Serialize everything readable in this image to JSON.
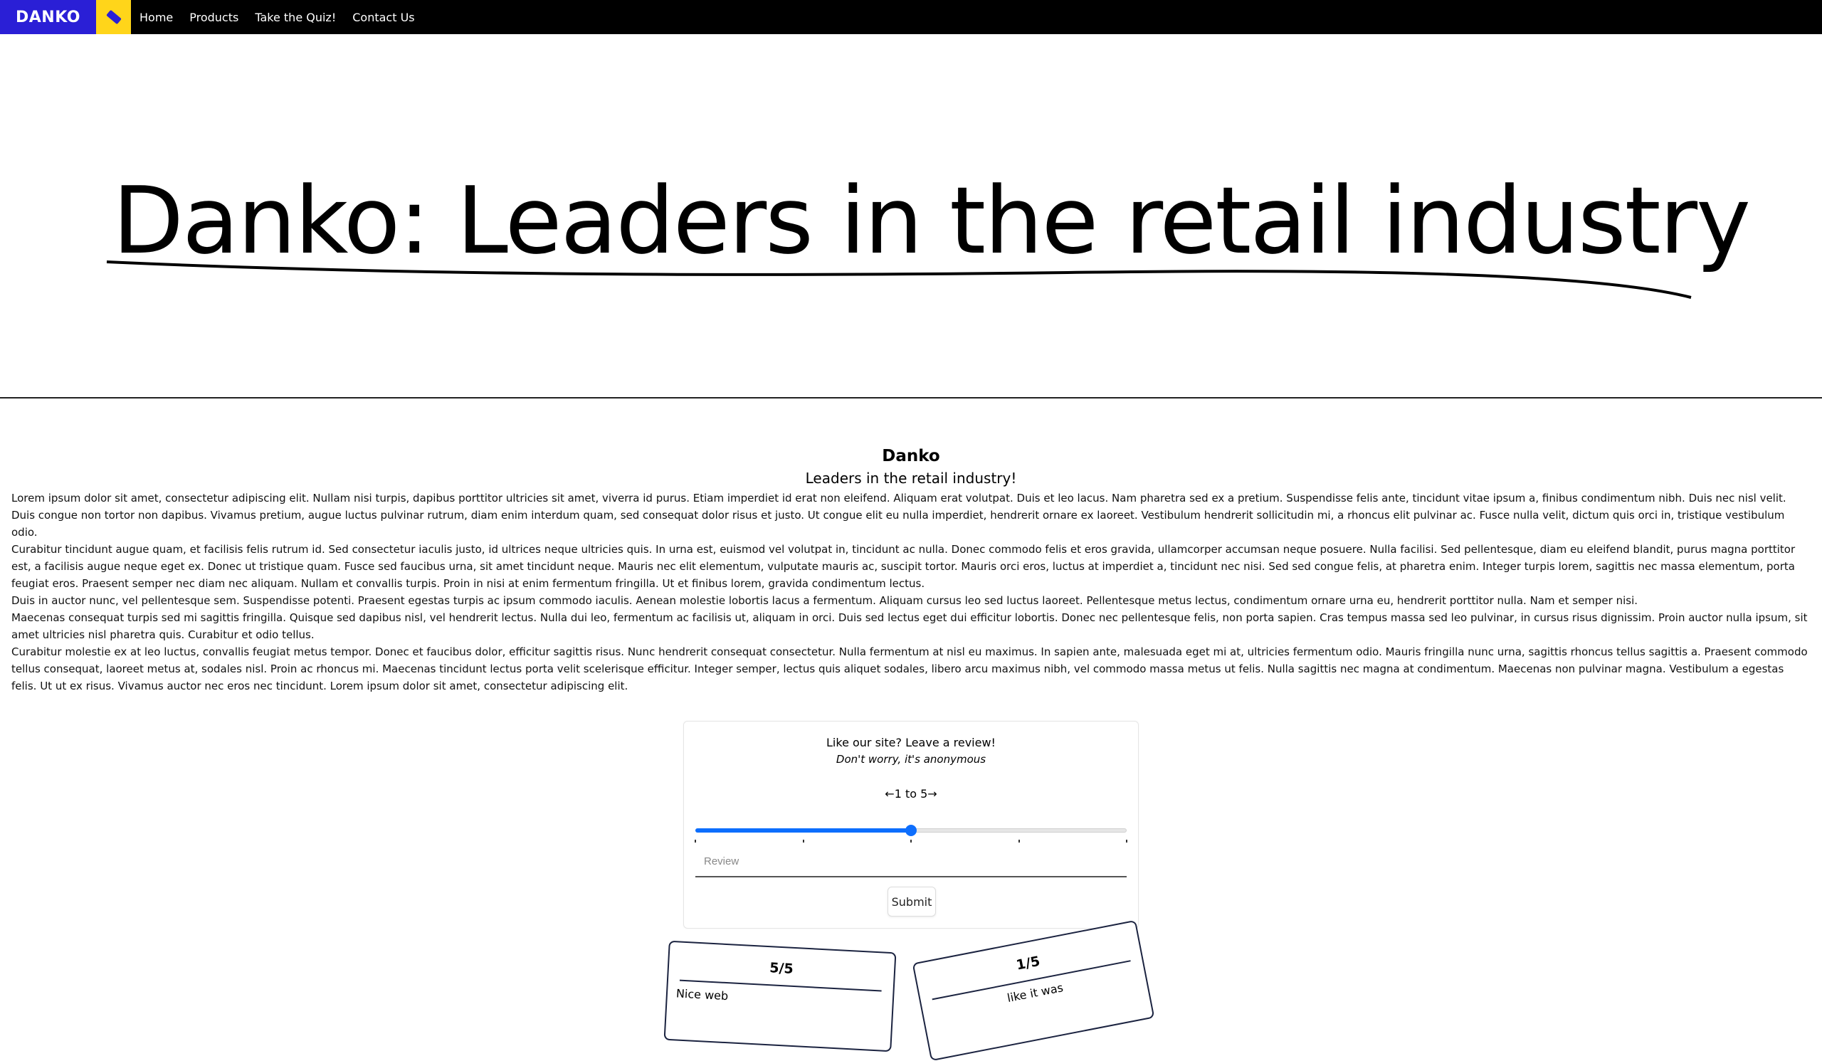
{
  "nav": {
    "brand": "DANKO",
    "links": [
      "Home",
      "Products",
      "Take the Quiz!",
      "Contact Us"
    ]
  },
  "hero": {
    "title": "Danko: Leaders in the retail industry"
  },
  "content": {
    "title": "Danko",
    "subtitle": "Leaders in the retail industry!",
    "paragraphs": [
      "Lorem ipsum dolor sit amet, consectetur adipiscing elit. Nullam nisi turpis, dapibus porttitor ultricies sit amet, viverra id purus. Etiam imperdiet id erat non eleifend. Aliquam erat volutpat. Duis et leo lacus. Nam pharetra sed ex a pretium. Suspendisse felis ante, tincidunt vitae ipsum a, finibus condimentum nibh. Duis nec nisl velit. Duis congue non tortor non dapibus. Vivamus pretium, augue luctus pulvinar rutrum, diam enim interdum quam, sed consequat dolor risus et justo. Ut congue elit eu nulla imperdiet, hendrerit ornare ex laoreet. Vestibulum hendrerit sollicitudin mi, a rhoncus elit pulvinar ac. Fusce nulla velit, dictum quis orci in, tristique vestibulum odio.",
      "Curabitur tincidunt augue quam, et facilisis felis rutrum id. Sed consectetur iaculis justo, id ultrices neque ultricies quis. In urna est, euismod vel volutpat in, tincidunt ac nulla. Donec commodo felis et eros gravida, ullamcorper accumsan neque posuere. Nulla facilisi. Sed pellentesque, diam eu eleifend blandit, purus magna porttitor est, a facilisis augue neque eget ex. Donec ut tristique quam. Fusce sed faucibus urna, sit amet tincidunt neque. Mauris nec elit elementum, vulputate mauris ac, suscipit tortor. Mauris orci eros, luctus at imperdiet a, tincidunt nec nisi. Sed sed congue felis, at pharetra enim. Integer turpis lorem, sagittis nec massa elementum, porta feugiat eros. Praesent semper nec diam nec aliquam. Nullam et convallis turpis. Proin in nisi at enim fermentum fringilla. Ut et finibus lorem, gravida condimentum lectus.",
      "Duis in auctor nunc, vel pellentesque sem. Suspendisse potenti. Praesent egestas turpis ac ipsum commodo iaculis. Aenean molestie lobortis lacus a fermentum. Aliquam cursus leo sed luctus laoreet. Pellentesque metus lectus, condimentum ornare urna eu, hendrerit porttitor nulla. Nam et semper nisi.",
      "Maecenas consequat turpis sed mi sagittis fringilla. Quisque sed dapibus nisl, vel hendrerit lectus. Nulla dui leo, fermentum ac facilisis ut, aliquam in orci. Duis sed lectus eget dui efficitur lobortis. Donec nec pellentesque felis, non porta sapien. Cras tempus massa sed leo pulvinar, in cursus risus dignissim. Proin auctor nulla ipsum, sit amet ultricies nisl pharetra quis. Curabitur et odio tellus.",
      "Curabitur molestie ex at leo luctus, convallis feugiat metus tempor. Donec et faucibus dolor, efficitur sagittis risus. Nunc hendrerit consequat consectetur. Nulla fermentum at nisl eu maximus. In sapien ante, malesuada eget mi at, ultricies fermentum odio. Mauris fringilla nunc urna, sagittis rhoncus tellus sagittis a. Praesent commodo tellus consequat, laoreet metus at, sodales nisl. Proin ac rhoncus mi. Maecenas tincidunt lectus porta velit scelerisque efficitur. Integer semper, lectus quis aliquet sodales, libero arcu maximus nibh, vel commodo massa metus ut felis. Nulla sagittis nec magna at condimentum. Maecenas non pulvinar magna. Vestibulum a egestas felis. Ut ut ex risus. Vivamus auctor nec eros nec tincidunt. Lorem ipsum dolor sit amet, consectetur adipiscing elit."
    ]
  },
  "review": {
    "title": "Like our site? Leave a review!",
    "subtitle": "Don't worry, it's anonymous",
    "range_label": "←1 to 5→",
    "slider": {
      "min": 1,
      "max": 5,
      "value": 3
    },
    "input_placeholder": "Review",
    "submit_label": "Submit"
  },
  "cards": [
    {
      "score": "5/5",
      "text": "Nice web"
    },
    {
      "score": "1/5",
      "text": "like it was"
    }
  ],
  "colors": {
    "brand_bg": "#2a1fd6",
    "brand_tag": "#ffd51a",
    "accent": "#0d6efd"
  }
}
